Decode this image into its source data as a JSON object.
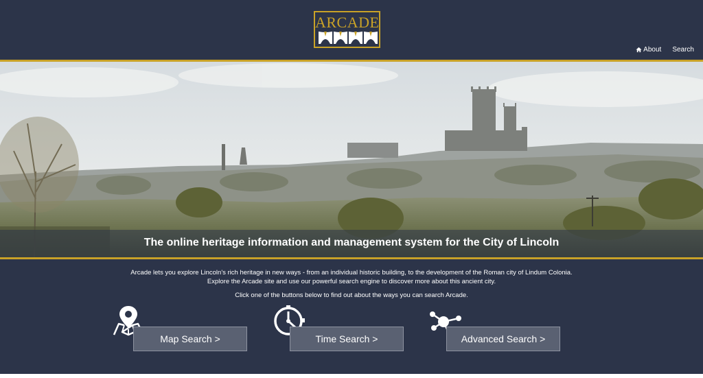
{
  "logo": {
    "text": "ARCADE"
  },
  "nav": {
    "about": "About",
    "search": "Search"
  },
  "hero": {
    "caption": "The online heritage information and management system for the City of Lincoln"
  },
  "intro": {
    "line1": "Arcade lets you explore Lincoln's rich heritage in new ways - from an individual historic building, to the development of the Roman city of Lindum Colonia.",
    "line2": "Explore the Arcade site and use our powerful search engine to discover more about this ancient city.",
    "prompt": "Click one of the buttons below to find out about the ways you can search Arcade."
  },
  "buttons": {
    "map": "Map Search >",
    "time": "Time Search >",
    "advanced": "Advanced Search >"
  },
  "icons": {
    "map": "map-pin-icon",
    "time": "stopwatch-icon",
    "advanced": "network-nodes-icon",
    "home": "home-icon"
  },
  "colors": {
    "background": "#2c3449",
    "accent": "#c9a227",
    "button": "#5a6172"
  }
}
